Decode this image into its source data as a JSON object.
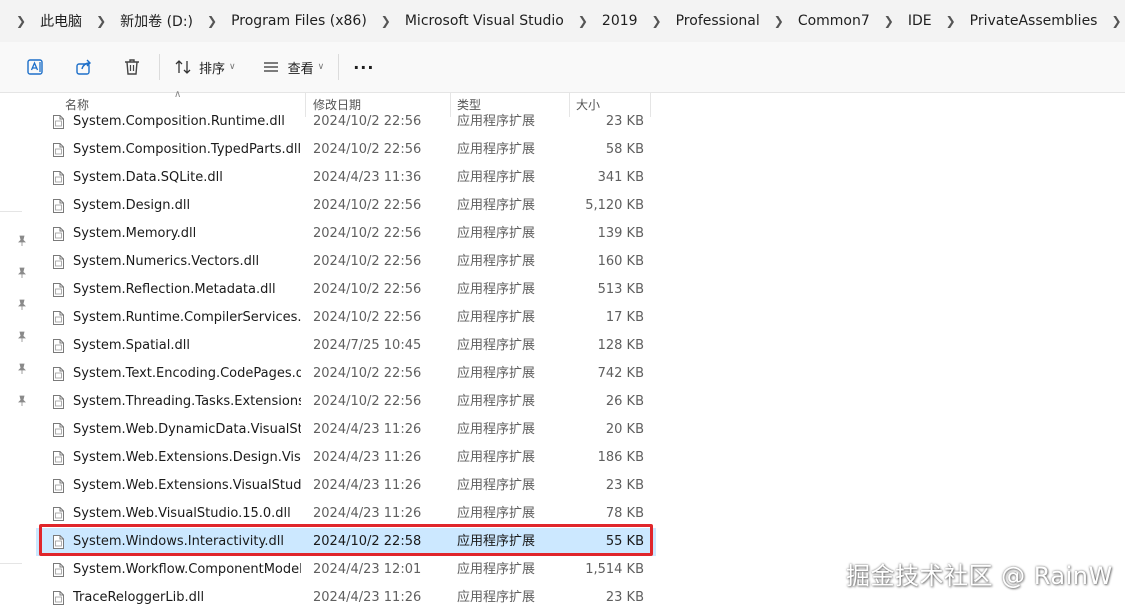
{
  "breadcrumb": {
    "items": [
      "此电脑",
      "新加卷 (D:)",
      "Program Files (x86)",
      "Microsoft Visual Studio",
      "2019",
      "Professional",
      "Common7",
      "IDE",
      "PrivateAssemblies"
    ]
  },
  "toolbar": {
    "sort_label": "排序",
    "view_label": "查看",
    "more_label": "···"
  },
  "columns": {
    "name": "名称",
    "date": "修改日期",
    "type": "类型",
    "size": "大小"
  },
  "files": [
    {
      "name": "System.Composition.Runtime.dll",
      "date": "2024/10/2 22:56",
      "type": "应用程序扩展",
      "size": "23 KB"
    },
    {
      "name": "System.Composition.TypedParts.dll",
      "date": "2024/10/2 22:56",
      "type": "应用程序扩展",
      "size": "58 KB"
    },
    {
      "name": "System.Data.SQLite.dll",
      "date": "2024/4/23 11:36",
      "type": "应用程序扩展",
      "size": "341 KB"
    },
    {
      "name": "System.Design.dll",
      "date": "2024/10/2 22:56",
      "type": "应用程序扩展",
      "size": "5,120 KB"
    },
    {
      "name": "System.Memory.dll",
      "date": "2024/10/2 22:56",
      "type": "应用程序扩展",
      "size": "139 KB"
    },
    {
      "name": "System.Numerics.Vectors.dll",
      "date": "2024/10/2 22:56",
      "type": "应用程序扩展",
      "size": "160 KB"
    },
    {
      "name": "System.Reflection.Metadata.dll",
      "date": "2024/10/2 22:56",
      "type": "应用程序扩展",
      "size": "513 KB"
    },
    {
      "name": "System.Runtime.CompilerServices.Un...",
      "date": "2024/10/2 22:56",
      "type": "应用程序扩展",
      "size": "17 KB"
    },
    {
      "name": "System.Spatial.dll",
      "date": "2024/7/25 10:45",
      "type": "应用程序扩展",
      "size": "128 KB"
    },
    {
      "name": "System.Text.Encoding.CodePages.dll",
      "date": "2024/10/2 22:56",
      "type": "应用程序扩展",
      "size": "742 KB"
    },
    {
      "name": "System.Threading.Tasks.Extensions.dll",
      "date": "2024/10/2 22:56",
      "type": "应用程序扩展",
      "size": "26 KB"
    },
    {
      "name": "System.Web.DynamicData.VisualStudi...",
      "date": "2024/4/23 11:26",
      "type": "应用程序扩展",
      "size": "20 KB"
    },
    {
      "name": "System.Web.Extensions.Design.Visual...",
      "date": "2024/4/23 11:26",
      "type": "应用程序扩展",
      "size": "186 KB"
    },
    {
      "name": "System.Web.Extensions.VisualStudio....",
      "date": "2024/4/23 11:26",
      "type": "应用程序扩展",
      "size": "23 KB"
    },
    {
      "name": "System.Web.VisualStudio.15.0.dll",
      "date": "2024/4/23 11:26",
      "type": "应用程序扩展",
      "size": "78 KB"
    },
    {
      "name": "System.Windows.Interactivity.dll",
      "date": "2024/10/2 22:58",
      "type": "应用程序扩展",
      "size": "55 KB",
      "selected": true
    },
    {
      "name": "System.Workflow.ComponentModel.dll",
      "date": "2024/4/23 12:01",
      "type": "应用程序扩展",
      "size": "1,514 KB"
    },
    {
      "name": "TraceReloggerLib.dll",
      "date": "2024/4/23 11:26",
      "type": "应用程序扩展",
      "size": "23 KB"
    }
  ],
  "watermark": "掘金技术社区 @ RainW",
  "colors": {
    "selection_bg": "#cce8ff",
    "highlight_border": "#e0262b"
  }
}
